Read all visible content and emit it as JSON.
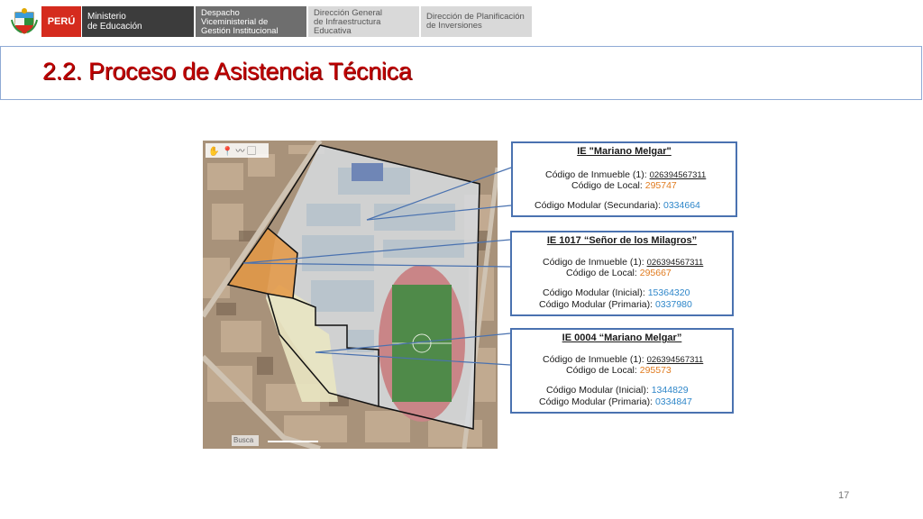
{
  "header": {
    "peru": "PERÚ",
    "ministerio": "Ministerio\nde Educación",
    "despacho": "Despacho\nViceministerial de\nGestión Institucional",
    "dgie": "Dirección General\nde Infraestructura\nEducativa",
    "dpi": "Dirección de Planificación\nde Inversiones"
  },
  "title": "2.2. Proceso de Asistencia Técnica",
  "map": {
    "search_label": "Busca"
  },
  "boxes": [
    {
      "title": "IE \"Mariano Melgar\"",
      "inmueble_label": "Código de Inmueble (1): ",
      "inmueble_value": "026394567311",
      "local_label": "Código de Local: ",
      "local_value": "295747",
      "modular1_label": "Código Modular (Secundaria): ",
      "modular1_value": "0334664"
    },
    {
      "title": "IE 1017 “Señor de los Milagros”",
      "inmueble_label": "Código de Inmueble (1): ",
      "inmueble_value": "026394567311",
      "local_label": "Código de Local: ",
      "local_value": "295667",
      "modular1_label": "Código Modular (Inicial): ",
      "modular1_value": "15364320",
      "modular2_label": "Código Modular (Primaria): ",
      "modular2_value": "0337980"
    },
    {
      "title": "IE 0004 “Mariano Melgar”",
      "inmueble_label": "Código de Inmueble (1): ",
      "inmueble_value": "026394567311",
      "local_label": "Código de Local: ",
      "local_value": "295573",
      "modular1_label": "Código Modular (Inicial): ",
      "modular1_value": "1344829",
      "modular2_label": "Código Modular (Primaria): ",
      "modular2_value": "0334847"
    }
  ],
  "page_number": "17",
  "colors": {
    "title": "#c00000",
    "box_border": "#4a72b0",
    "value_orange": "#e07b1f",
    "value_blue": "#2e86c9",
    "peru_red": "#d52b1e"
  }
}
